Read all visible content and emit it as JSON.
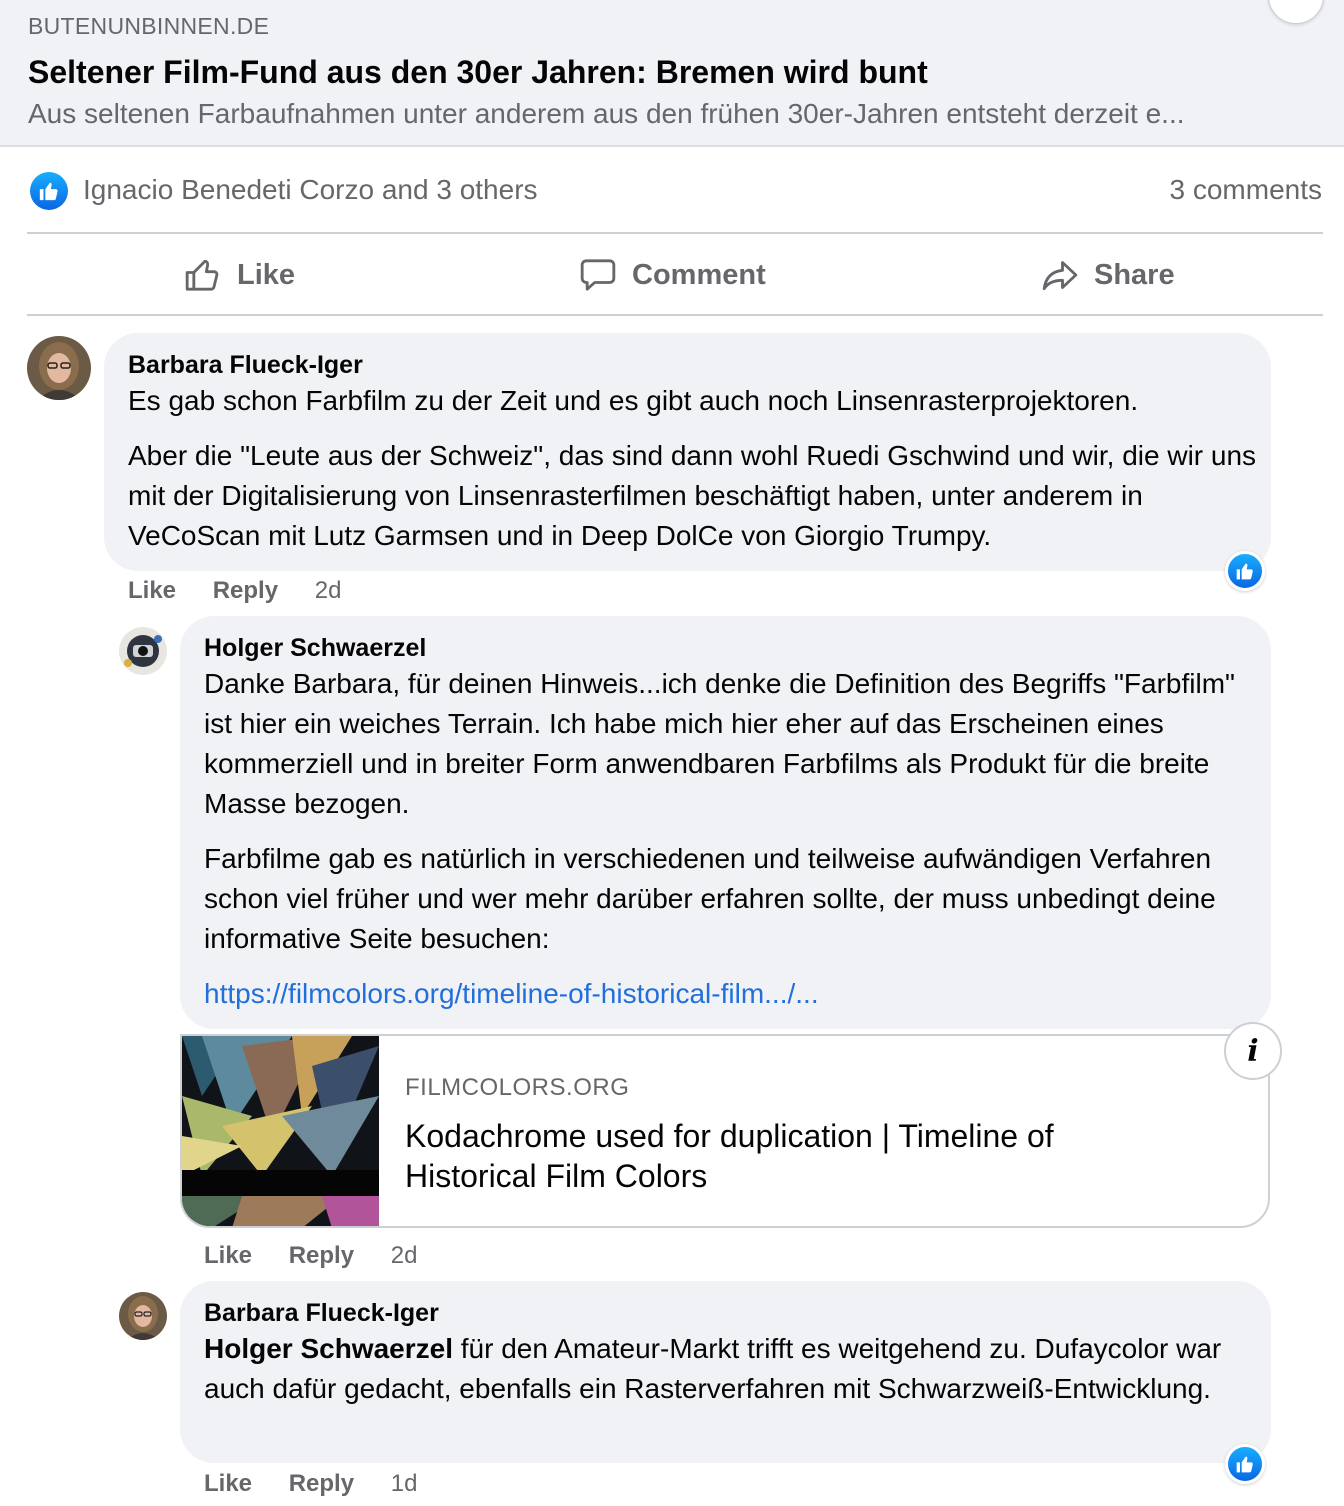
{
  "link_preview": {
    "domain": "BUTENUNBINNEN.DE",
    "title": "Seltener Film-Fund aus den 30er Jahren: Bremen wird bunt",
    "description": "Aus seltenen Farbaufnahmen unter anderem aus den frühen 30er-Jahren entsteht derzeit e..."
  },
  "reactions": {
    "icon": "like-icon",
    "summary": "Ignacio Benedeti Corzo and 3 others",
    "comments": "3 comments"
  },
  "actions": {
    "like": "Like",
    "comment": "Comment",
    "share": "Share"
  },
  "comments": [
    {
      "author": "Barbara Flueck-Iger",
      "paragraphs": [
        "Es gab schon Farbfilm zu der Zeit und es gibt auch noch Linsenrasterprojektoren.",
        "Aber die \"Leute aus der Schweiz\", das sind dann wohl Ruedi Gschwind und wir, die wir uns mit der Digitalisierung von Linsenrasterfilmen beschäftigt haben, unter anderem in VeCoScan mit Lutz Garmsen und in Deep DolCe von Giorgio Trumpy."
      ],
      "like": "Like",
      "reply": "Reply",
      "time": "2d",
      "reaction": "like-icon"
    },
    {
      "author": "Holger Schwaerzel",
      "paragraphs": [
        "Danke Barbara, für deinen Hinweis...ich denke die Definition des Begriffs \"Farbfilm\" ist hier ein weiches Terrain. Ich habe mich hier eher auf das Erscheinen eines kommerziell und in breiter Form anwendbaren Farbfilms als Produkt für die breite Masse bezogen.",
        "Farbfilme gab es natürlich in verschiedenen und teilweise aufwändigen Verfahren schon viel früher und wer mehr darüber erfahren sollte, der muss unbedingt deine informative Seite besuchen:"
      ],
      "link": "https://filmcolors.org/timeline-of-historical-film.../...",
      "card": {
        "domain": "FILMCOLORS.ORG",
        "title": "Kodachrome used for duplication | Timeline of Historical Film Colors",
        "info": "i"
      },
      "like": "Like",
      "reply": "Reply",
      "time": "2d"
    },
    {
      "author": "Barbara Flueck-Iger",
      "mention": "Holger Schwaerzel",
      "text": " für den Amateur-Markt trifft es weitgehend zu. Dufaycolor war auch dafür gedacht, ebenfalls ein Rasterverfahren mit Schwarzweiß-Entwicklung.",
      "like": "Like",
      "reply": "Reply",
      "time": "1d",
      "reaction": "like-icon"
    }
  ],
  "colors": {
    "link": "#216fdb",
    "bubble": "#f0f2f5",
    "secondary_text": "#65676b",
    "like_blue": "#0a66e4"
  }
}
